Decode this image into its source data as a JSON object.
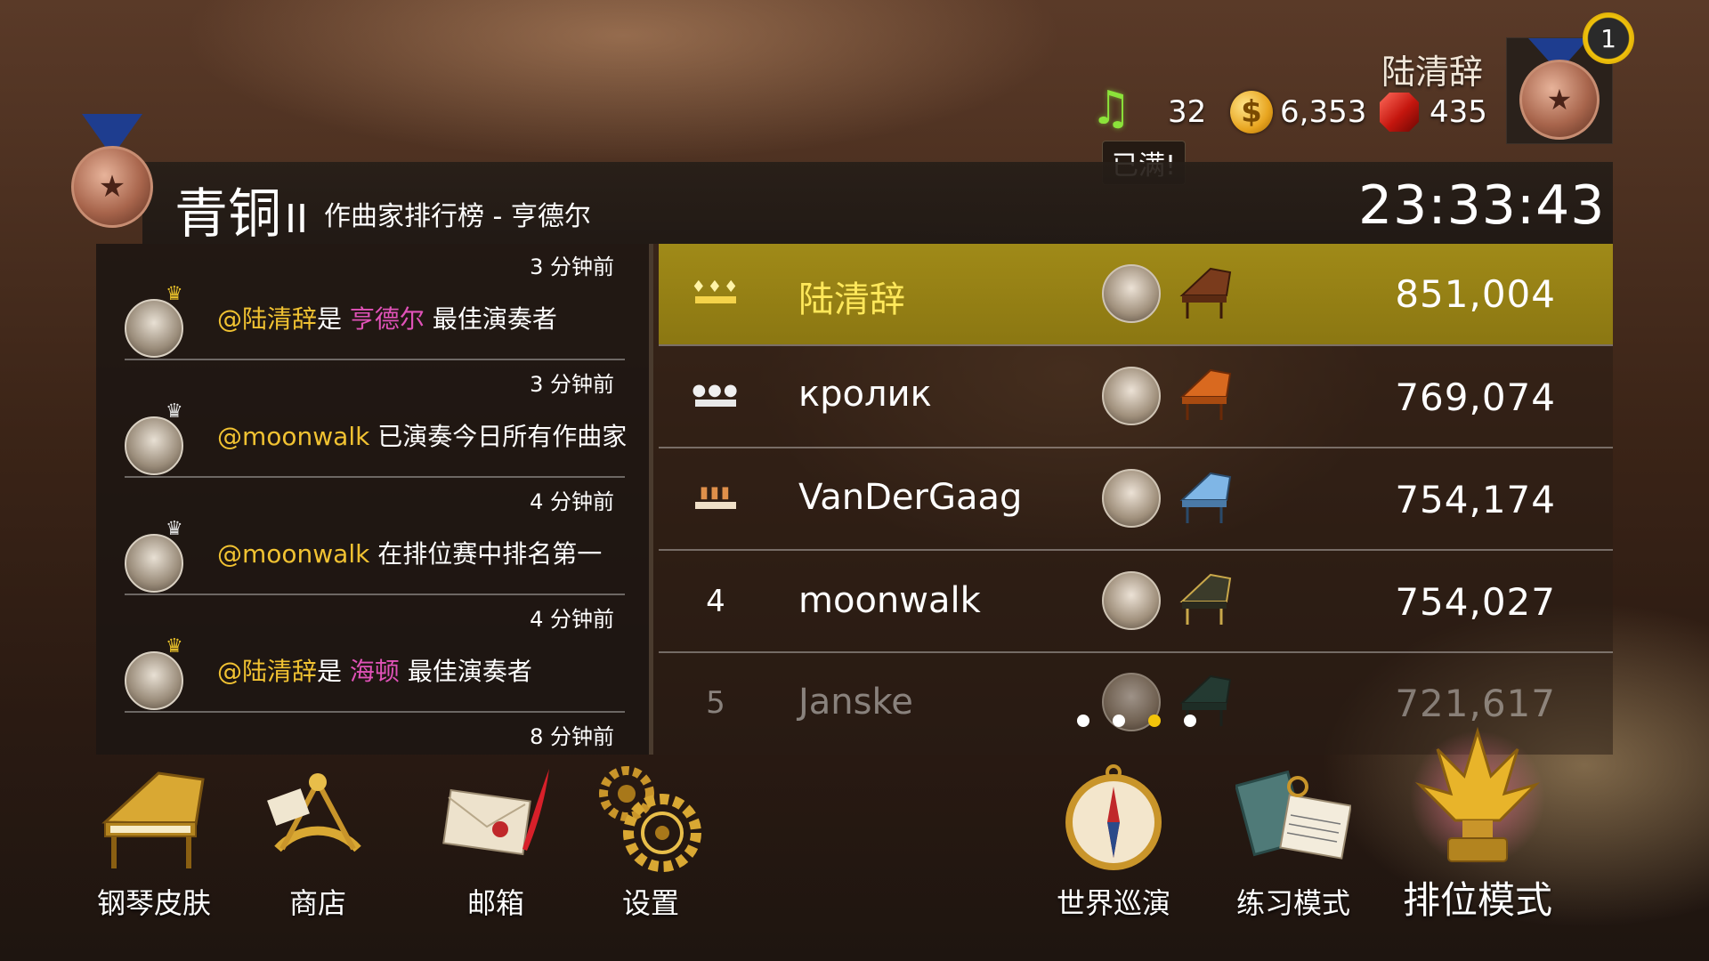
{
  "player": {
    "name": "陆清辞",
    "level_badge": "1",
    "notes": "32",
    "notes_status": "已满!",
    "coins": "6,353",
    "gems": "435"
  },
  "header": {
    "tier": "青铜",
    "tier_level": "II",
    "board_title": "作曲家排行榜 - 亨德尔",
    "countdown": "23:33:43"
  },
  "feed": [
    {
      "time": "3 分钟前",
      "crown": "gold",
      "user": "@陆清辞",
      "pre": "是 ",
      "composer": "亨德尔",
      "post": " 最佳演奏者"
    },
    {
      "time": "3 分钟前",
      "crown": "silver",
      "user": "@moonwalk",
      "pre": " 已演奏今日所有作曲家",
      "composer": "",
      "post": ""
    },
    {
      "time": "4 分钟前",
      "crown": "silver",
      "user": "@moonwalk",
      "pre": " 在排位赛中排名第一",
      "composer": "",
      "post": ""
    },
    {
      "time": "4 分钟前",
      "crown": "gold",
      "user": "@陆清辞",
      "pre": "是 ",
      "composer": "海顿",
      "post": " 最佳演奏者"
    }
  ],
  "feed_last_time": "8 分钟前",
  "leaderboard": [
    {
      "rank": "",
      "crown": "gold",
      "name": "陆清辞",
      "score": "851,004",
      "piano_color": "#7a3b1c",
      "highlight": true
    },
    {
      "rank": "",
      "crown": "silver",
      "name": "кролик",
      "score": "769,074",
      "piano_color": "#d9691f",
      "highlight": false
    },
    {
      "rank": "",
      "crown": "bronze",
      "name": "VanDerGaag",
      "score": "754,174",
      "piano_color": "#7fb6e6",
      "highlight": false
    },
    {
      "rank": "4",
      "crown": "",
      "name": "moonwalk",
      "score": "754,027",
      "piano_color": "#3b3b2a",
      "highlight": false
    },
    {
      "rank": "5",
      "crown": "",
      "name": "Janske",
      "score": "721,617",
      "piano_color": "#1f5a52",
      "highlight": false
    }
  ],
  "pagination": {
    "pages": 4,
    "active": 3
  },
  "menu": {
    "piano_skin": "钢琴皮肤",
    "shop": "商店",
    "mailbox": "邮箱",
    "settings": "设置",
    "world_tour": "世界巡演",
    "practice": "练习模式",
    "ranked": "排位模式"
  },
  "colors": {
    "highlight_row": "#9a8416",
    "gold_text": "#f1c232",
    "composer_text": "#e052b8",
    "notes_green": "#8be33a"
  }
}
